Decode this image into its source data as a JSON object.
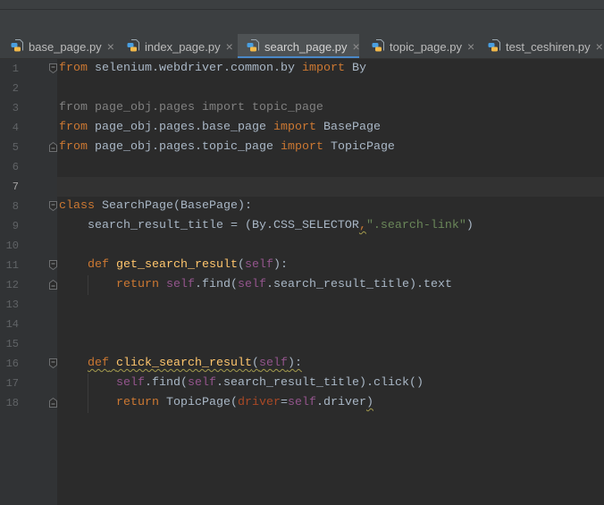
{
  "tabs": [
    {
      "label": "base_page.py",
      "active": false
    },
    {
      "label": "index_page.py",
      "active": false
    },
    {
      "label": "search_page.py",
      "active": true
    },
    {
      "label": "topic_page.py",
      "active": false
    },
    {
      "label": "test_ceshiren.py",
      "active": false
    }
  ],
  "tab_close_glyph": "×",
  "colors": {
    "tab_underline": "#4a88c7",
    "keyword": "#cc7832",
    "identifier": "#a9b7c6",
    "function": "#ffc66d",
    "self": "#94558d",
    "string": "#6a8759",
    "named_argument": "#aa4926",
    "unused": "#808080",
    "comma": "#cc7832",
    "line_number": "#606366",
    "current_line_number": "#a4a3a3",
    "current_line_background": "#323232",
    "warning_underline": "#a59c4d"
  },
  "editor": {
    "current_line": 7,
    "lines": [
      {
        "number": "1",
        "fold_marker": "fold-start-icon",
        "tokens": [
          {
            "keyword": "from"
          },
          {
            "identifier": " selenium.webdriver.common.by "
          },
          {
            "keyword": "import"
          },
          {
            "identifier": " By"
          }
        ]
      },
      {
        "number": "2",
        "tokens": []
      },
      {
        "number": "3",
        "tokens": [
          {
            "unused": "from page_obj.pages import topic_page"
          }
        ]
      },
      {
        "number": "4",
        "tokens": [
          {
            "keyword": "from"
          },
          {
            "identifier": " page_obj.pages.base_page "
          },
          {
            "keyword": "import"
          },
          {
            "identifier": " BasePage"
          }
        ]
      },
      {
        "number": "5",
        "fold_marker": "fold-end-icon",
        "tokens": [
          {
            "keyword": "from"
          },
          {
            "identifier": " page_obj.pages.topic_page "
          },
          {
            "keyword": "import"
          },
          {
            "identifier": " TopicPage"
          }
        ]
      },
      {
        "number": "6",
        "tokens": []
      },
      {
        "number": "7",
        "tokens": []
      },
      {
        "number": "8",
        "fold_marker": "fold-start-icon",
        "tokens": [
          {
            "keyword": "class"
          },
          {
            "identifier": " SearchPage(BasePage):"
          }
        ]
      },
      {
        "number": "9",
        "tokens": [
          {
            "identifier": "    search_result_title = (By.CSS_SELECTOR"
          },
          {
            "comma": ",",
            "warning": true
          },
          {
            "string": "\".search-link\""
          },
          {
            "identifier": ")"
          }
        ]
      },
      {
        "number": "10",
        "tokens": []
      },
      {
        "number": "11",
        "fold_marker": "fold-start-icon",
        "tokens": [
          {
            "identifier": "    "
          },
          {
            "keyword": "def"
          },
          {
            "identifier": " "
          },
          {
            "function": "get_search_result"
          },
          {
            "identifier": "("
          },
          {
            "self": "self"
          },
          {
            "identifier": "):"
          }
        ]
      },
      {
        "number": "12",
        "fold_marker": "fold-end-icon",
        "tokens": [
          {
            "identifier": "        "
          },
          {
            "keyword": "return"
          },
          {
            "identifier": " "
          },
          {
            "self": "self"
          },
          {
            "identifier": ".find("
          },
          {
            "self": "self"
          },
          {
            "identifier": ".search_result_title).text"
          }
        ]
      },
      {
        "number": "13",
        "tokens": []
      },
      {
        "number": "14",
        "tokens": []
      },
      {
        "number": "15",
        "tokens": []
      },
      {
        "number": "16",
        "fold_marker": "fold-start-icon",
        "tokens": [
          {
            "identifier": "    "
          },
          {
            "keyword": "def",
            "warning": true
          },
          {
            "identifier": " ",
            "warning": true
          },
          {
            "function": "click_search_result",
            "warning": true
          },
          {
            "identifier": "(",
            "warning": true
          },
          {
            "self": "self",
            "warning": true
          },
          {
            "identifier": "):",
            "warning": true
          }
        ]
      },
      {
        "number": "17",
        "tokens": [
          {
            "identifier": "        "
          },
          {
            "self": "self"
          },
          {
            "identifier": ".find("
          },
          {
            "self": "self"
          },
          {
            "identifier": ".search_result_title).click()"
          }
        ]
      },
      {
        "number": "18",
        "fold_marker": "fold-end-icon",
        "tokens": [
          {
            "identifier": "        "
          },
          {
            "keyword": "return"
          },
          {
            "identifier": " TopicPage("
          },
          {
            "named_argument": "driver"
          },
          {
            "identifier": "="
          },
          {
            "self": "self"
          },
          {
            "identifier": ".driver"
          },
          {
            "identifier": ")",
            "warning": true
          }
        ]
      }
    ]
  }
}
